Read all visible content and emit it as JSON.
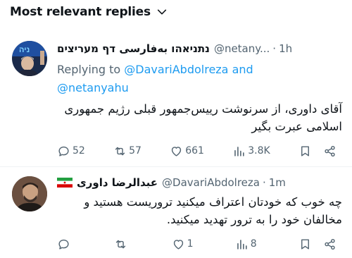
{
  "header": {
    "title": "Most relevant replies"
  },
  "replies": [
    {
      "display_name": "נתניאהו بەفارسی דף מעריצים",
      "handle": "@netany...",
      "separator": "·",
      "time": "1h",
      "replying_prefix": "Replying to ",
      "replying_user1": "@DavariAbdolreza",
      "replying_and": " and",
      "replying_user2": "@netanyahu",
      "text": "آقای داوری، از سرنوشت رییس‌جمهور قبلی رژیم جمهوری اسلامی عبرت بگیر",
      "stats": {
        "replies": "52",
        "reposts": "57",
        "likes": "661",
        "views": "3.8K"
      }
    },
    {
      "display_name": "عبدالرضا داوری",
      "handle": "@DavariAbdolreza",
      "separator": "·",
      "time": "1m",
      "text": "چه خوب که خودتان اعتراف میکنید تروریست هستید و مخالفان خود را به ترور تهدید میکنید.",
      "stats": {
        "replies": "",
        "reposts": "",
        "likes": "1",
        "views": "8"
      }
    }
  ],
  "colors": {
    "text": "#0f1419",
    "secondary": "#536471",
    "link": "#1d9bf0",
    "separator": "#eff3f4"
  },
  "icons": [
    "chevron-down-icon",
    "more-icon",
    "reply-icon",
    "repost-icon",
    "like-icon",
    "views-icon",
    "bookmark-icon",
    "share-icon",
    "iran-flag-icon"
  ]
}
